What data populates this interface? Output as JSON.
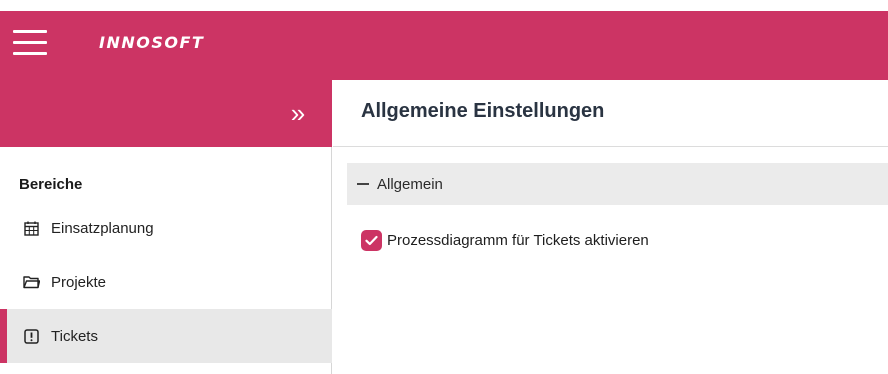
{
  "header": {
    "logo_text": "INNOSOFT",
    "brand_color": "#cc3464"
  },
  "sidebar": {
    "collapse_glyph": "»",
    "heading": "Bereiche",
    "items": [
      {
        "label": "Einsatzplanung",
        "icon": "calendar-icon",
        "active": false
      },
      {
        "label": "Projekte",
        "icon": "folder-icon",
        "active": false
      },
      {
        "label": "Tickets",
        "icon": "ticket-alert-icon",
        "active": true
      }
    ]
  },
  "main": {
    "title": "Allgemeine Einstellungen",
    "section": {
      "label": "Allgemein",
      "expanded": true
    },
    "options": [
      {
        "label": "Prozessdiagramm für Tickets aktivieren",
        "checked": true
      }
    ]
  }
}
